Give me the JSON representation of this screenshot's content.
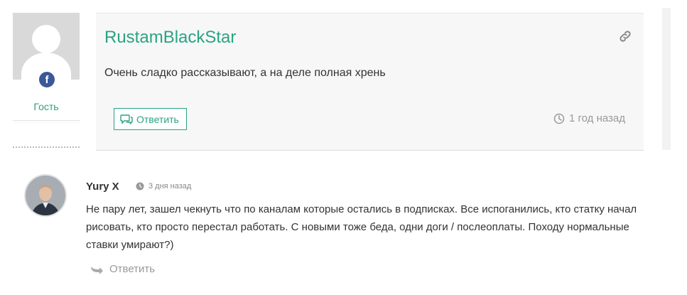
{
  "comment1": {
    "author": "RustamBlackStar",
    "role_label": "Гость",
    "avatar_badge": "f",
    "text": "Очень сладко рассказывают, а на деле полная хрень",
    "reply_label": "Ответить",
    "time": "1 год назад",
    "accent_color": "#2aa382"
  },
  "comment2": {
    "author": "Yury X",
    "time": "3 дня назад",
    "text": "Не пару лет, зашел чекнуть что по каналам которые остались в подписках. Все испоганились, кто статку начал рисовать, кто просто перестал работать. С новыми тоже беда, одни доги / послеоплаты. Походу нормальные ставки умирают?)",
    "reply_label": "Ответить"
  },
  "icons": [
    "facebook-icon",
    "link-icon",
    "reply-chat-icon",
    "clock-icon",
    "reply-arrow-icon"
  ]
}
